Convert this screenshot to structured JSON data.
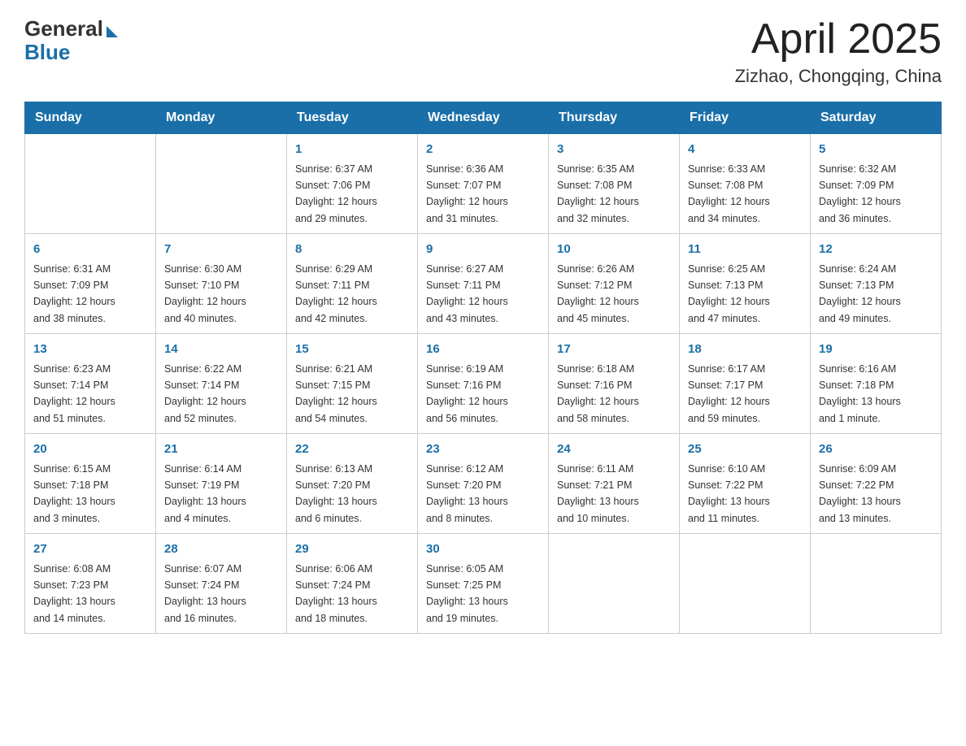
{
  "header": {
    "logo_general": "General",
    "logo_blue": "Blue",
    "month_title": "April 2025",
    "location": "Zizhao, Chongqing, China"
  },
  "days_of_week": [
    "Sunday",
    "Monday",
    "Tuesday",
    "Wednesday",
    "Thursday",
    "Friday",
    "Saturday"
  ],
  "weeks": [
    [
      {
        "day": "",
        "info": ""
      },
      {
        "day": "",
        "info": ""
      },
      {
        "day": "1",
        "info": "Sunrise: 6:37 AM\nSunset: 7:06 PM\nDaylight: 12 hours\nand 29 minutes."
      },
      {
        "day": "2",
        "info": "Sunrise: 6:36 AM\nSunset: 7:07 PM\nDaylight: 12 hours\nand 31 minutes."
      },
      {
        "day": "3",
        "info": "Sunrise: 6:35 AM\nSunset: 7:08 PM\nDaylight: 12 hours\nand 32 minutes."
      },
      {
        "day": "4",
        "info": "Sunrise: 6:33 AM\nSunset: 7:08 PM\nDaylight: 12 hours\nand 34 minutes."
      },
      {
        "day": "5",
        "info": "Sunrise: 6:32 AM\nSunset: 7:09 PM\nDaylight: 12 hours\nand 36 minutes."
      }
    ],
    [
      {
        "day": "6",
        "info": "Sunrise: 6:31 AM\nSunset: 7:09 PM\nDaylight: 12 hours\nand 38 minutes."
      },
      {
        "day": "7",
        "info": "Sunrise: 6:30 AM\nSunset: 7:10 PM\nDaylight: 12 hours\nand 40 minutes."
      },
      {
        "day": "8",
        "info": "Sunrise: 6:29 AM\nSunset: 7:11 PM\nDaylight: 12 hours\nand 42 minutes."
      },
      {
        "day": "9",
        "info": "Sunrise: 6:27 AM\nSunset: 7:11 PM\nDaylight: 12 hours\nand 43 minutes."
      },
      {
        "day": "10",
        "info": "Sunrise: 6:26 AM\nSunset: 7:12 PM\nDaylight: 12 hours\nand 45 minutes."
      },
      {
        "day": "11",
        "info": "Sunrise: 6:25 AM\nSunset: 7:13 PM\nDaylight: 12 hours\nand 47 minutes."
      },
      {
        "day": "12",
        "info": "Sunrise: 6:24 AM\nSunset: 7:13 PM\nDaylight: 12 hours\nand 49 minutes."
      }
    ],
    [
      {
        "day": "13",
        "info": "Sunrise: 6:23 AM\nSunset: 7:14 PM\nDaylight: 12 hours\nand 51 minutes."
      },
      {
        "day": "14",
        "info": "Sunrise: 6:22 AM\nSunset: 7:14 PM\nDaylight: 12 hours\nand 52 minutes."
      },
      {
        "day": "15",
        "info": "Sunrise: 6:21 AM\nSunset: 7:15 PM\nDaylight: 12 hours\nand 54 minutes."
      },
      {
        "day": "16",
        "info": "Sunrise: 6:19 AM\nSunset: 7:16 PM\nDaylight: 12 hours\nand 56 minutes."
      },
      {
        "day": "17",
        "info": "Sunrise: 6:18 AM\nSunset: 7:16 PM\nDaylight: 12 hours\nand 58 minutes."
      },
      {
        "day": "18",
        "info": "Sunrise: 6:17 AM\nSunset: 7:17 PM\nDaylight: 12 hours\nand 59 minutes."
      },
      {
        "day": "19",
        "info": "Sunrise: 6:16 AM\nSunset: 7:18 PM\nDaylight: 13 hours\nand 1 minute."
      }
    ],
    [
      {
        "day": "20",
        "info": "Sunrise: 6:15 AM\nSunset: 7:18 PM\nDaylight: 13 hours\nand 3 minutes."
      },
      {
        "day": "21",
        "info": "Sunrise: 6:14 AM\nSunset: 7:19 PM\nDaylight: 13 hours\nand 4 minutes."
      },
      {
        "day": "22",
        "info": "Sunrise: 6:13 AM\nSunset: 7:20 PM\nDaylight: 13 hours\nand 6 minutes."
      },
      {
        "day": "23",
        "info": "Sunrise: 6:12 AM\nSunset: 7:20 PM\nDaylight: 13 hours\nand 8 minutes."
      },
      {
        "day": "24",
        "info": "Sunrise: 6:11 AM\nSunset: 7:21 PM\nDaylight: 13 hours\nand 10 minutes."
      },
      {
        "day": "25",
        "info": "Sunrise: 6:10 AM\nSunset: 7:22 PM\nDaylight: 13 hours\nand 11 minutes."
      },
      {
        "day": "26",
        "info": "Sunrise: 6:09 AM\nSunset: 7:22 PM\nDaylight: 13 hours\nand 13 minutes."
      }
    ],
    [
      {
        "day": "27",
        "info": "Sunrise: 6:08 AM\nSunset: 7:23 PM\nDaylight: 13 hours\nand 14 minutes."
      },
      {
        "day": "28",
        "info": "Sunrise: 6:07 AM\nSunset: 7:24 PM\nDaylight: 13 hours\nand 16 minutes."
      },
      {
        "day": "29",
        "info": "Sunrise: 6:06 AM\nSunset: 7:24 PM\nDaylight: 13 hours\nand 18 minutes."
      },
      {
        "day": "30",
        "info": "Sunrise: 6:05 AM\nSunset: 7:25 PM\nDaylight: 13 hours\nand 19 minutes."
      },
      {
        "day": "",
        "info": ""
      },
      {
        "day": "",
        "info": ""
      },
      {
        "day": "",
        "info": ""
      }
    ]
  ]
}
